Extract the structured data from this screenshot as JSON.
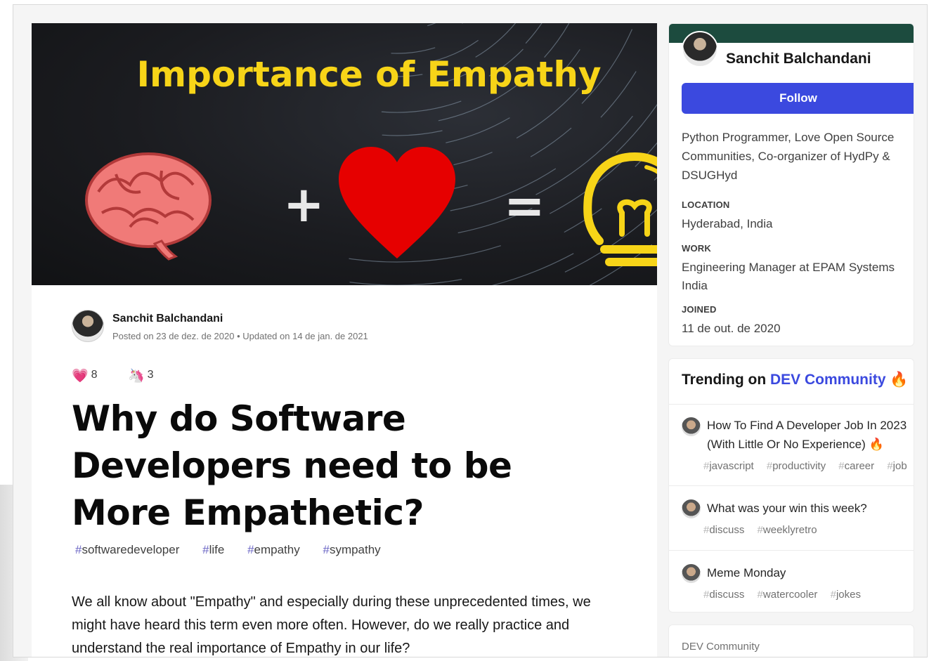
{
  "cover": {
    "title": "Importance of Empathy",
    "symbols": {
      "plus": "+",
      "equals": "="
    },
    "icons": [
      "brain-icon",
      "heart-icon",
      "lightbulb-icon"
    ]
  },
  "author": {
    "name": "Sanchit Balchandani",
    "meta": "Posted on 23 de dez. de 2020 • Updated on 14 de jan. de 2021"
  },
  "reactions": [
    {
      "icon": "heart-icon",
      "glyph": "💗",
      "count": "8"
    },
    {
      "icon": "unicorn-icon",
      "glyph": "🦄",
      "count": "3"
    }
  ],
  "post": {
    "title": "Why do Software Developers need to be More Empathetic?",
    "tags": [
      "softwaredeveloper",
      "life",
      "empathy",
      "sympathy"
    ],
    "body": "We all know about \"Empathy\" and especially during these unprecedented times, we might have heard this term even more often. However, do we really practice and understand the real importance of Empathy in our life?"
  },
  "sidebar": {
    "name": "Sanchit Balchandani",
    "follow_label": "Follow",
    "bio": "Python Programmer, Love Open Source Communities, Co-organizer of HydPy & DSUGHyd",
    "location_label": "LOCATION",
    "location": "Hyderabad, India",
    "work_label": "WORK",
    "work": "Engineering Manager at EPAM Systems India",
    "joined_label": "JOINED",
    "joined": "11 de out. de 2020",
    "accent_color": "#1c4b3e",
    "button_color": "#3b49df"
  },
  "trending": {
    "prefix": "Trending on",
    "community": "DEV Community",
    "items": [
      {
        "title": "How To Find A Developer Job In 2023 (With Little Or No Experience) 🔥",
        "tags": [
          "javascript",
          "productivity",
          "career",
          "job"
        ]
      },
      {
        "title": "What was your win this week?",
        "tags": [
          "discuss",
          "weeklyretro"
        ]
      },
      {
        "title": "Meme Monday",
        "tags": [
          "discuss",
          "watercooler",
          "jokes"
        ]
      }
    ]
  },
  "bottom_card": {
    "label": "DEV Community"
  }
}
